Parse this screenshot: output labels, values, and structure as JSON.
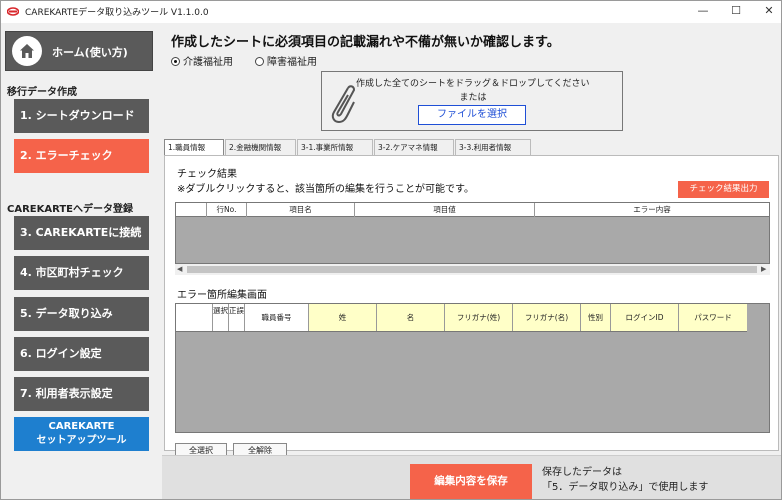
{
  "window": {
    "title": "CAREKARTEデータ取り込みツール V1.1.0.0",
    "controls": {
      "minimize": "—",
      "maximize": "☐",
      "close": "✕"
    }
  },
  "sidebar": {
    "home_label": "ホーム(使い方)",
    "section_migration": "移行データ作成",
    "section_register": "CAREKARTEへデータ登録",
    "items": [
      {
        "label": "1. シートダウンロード"
      },
      {
        "label": "2. エラーチェック"
      },
      {
        "label": "3. CAREKARTEに接続"
      },
      {
        "label": "4. 市区町村チェック"
      },
      {
        "label": "5. データ取り込み"
      },
      {
        "label": "6. ログイン設定"
      },
      {
        "label": "7. 利用者表示設定"
      }
    ],
    "setup_line1": "CAREKARTE",
    "setup_line2": "セットアップツール",
    "colors": {
      "button": "#5a5a5a",
      "active": "#f5634a",
      "setup": "#1e7fcf"
    }
  },
  "main": {
    "heading": "作成したシートに必須項目の記載漏れや不備が無いか確認します。",
    "radio_care": "介護福祉用",
    "radio_disability": "障害福祉用",
    "radio_selected": "介護福祉用",
    "drop_text1": "作成した全てのシートをドラッグ＆ドロップしてください",
    "drop_text2": "または",
    "file_button": "ファイルを選択",
    "tabs": [
      {
        "label": "1.職員情報"
      },
      {
        "label": "2.金融機関情報"
      },
      {
        "label": "3-1.事業所情報"
      },
      {
        "label": "3-2.ケアマネ情報"
      },
      {
        "label": "3-3.利用者情報"
      }
    ],
    "check_result_label": "チェック結果",
    "check_result_note": "※ダブルクリックすると、該当箇所の編集を行うことが可能です。",
    "export_button": "チェック結果出力",
    "result_columns": [
      "行No.",
      "項目名",
      "項目値",
      "エラー内容"
    ],
    "edit_label": "エラー箇所編集画面",
    "edit_columns": [
      "選択",
      "正誤",
      "職員番号",
      "姓",
      "名",
      "フリガナ(姓)",
      "フリガナ(名)",
      "性別",
      "ログインID",
      "パスワード"
    ],
    "select_all": "全選択",
    "deselect_all": "全解除",
    "save_button": "編集内容を保存",
    "note_line1": "保存したデータは",
    "note_line2": "「5．データ取り込み」で使用します"
  }
}
